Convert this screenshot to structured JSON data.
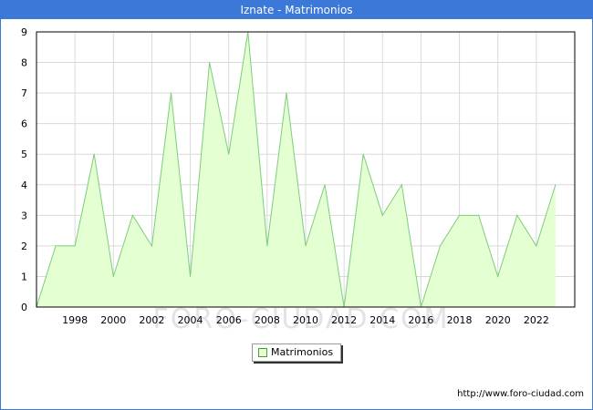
{
  "header": {
    "title": "Iznate - Matrimonios"
  },
  "footer": {
    "url": "http://www.foro-ciudad.com"
  },
  "watermark": {
    "text": "FORO-CIUDAD.COM"
  },
  "colors": {
    "title_bar": "#3b78d8",
    "area_fill": "#e4ffd2",
    "line": "#7ccd7c",
    "grid": "#d9d9d9"
  },
  "chart_data": {
    "type": "area",
    "title": "Iznate - Matrimonios",
    "xlabel": "",
    "ylabel": "",
    "x": [
      1996,
      1997,
      1998,
      1999,
      2000,
      2001,
      2002,
      2003,
      2004,
      2005,
      2006,
      2007,
      2008,
      2009,
      2010,
      2011,
      2012,
      2013,
      2014,
      2015,
      2016,
      2017,
      2018,
      2019,
      2020,
      2021,
      2022,
      2023
    ],
    "series": [
      {
        "name": "Matrimonios",
        "values": [
          0,
          2,
          2,
          5,
          1,
          3,
          2,
          7,
          1,
          8,
          5,
          9,
          2,
          7,
          2,
          4,
          0,
          5,
          3,
          4,
          0,
          2,
          3,
          3,
          1,
          3,
          2,
          4
        ]
      }
    ],
    "xlim": [
      1996,
      2024
    ],
    "ylim": [
      0,
      9
    ],
    "x_ticks": [
      "1998",
      "2000",
      "2002",
      "2004",
      "2006",
      "2008",
      "2010",
      "2012",
      "2014",
      "2016",
      "2018",
      "2020",
      "2022"
    ],
    "y_ticks": [
      "0",
      "1",
      "2",
      "3",
      "4",
      "5",
      "6",
      "7",
      "8",
      "9"
    ],
    "grid": true,
    "legend": {
      "position": "bottom-center",
      "entries": [
        "Matrimonios"
      ]
    }
  }
}
